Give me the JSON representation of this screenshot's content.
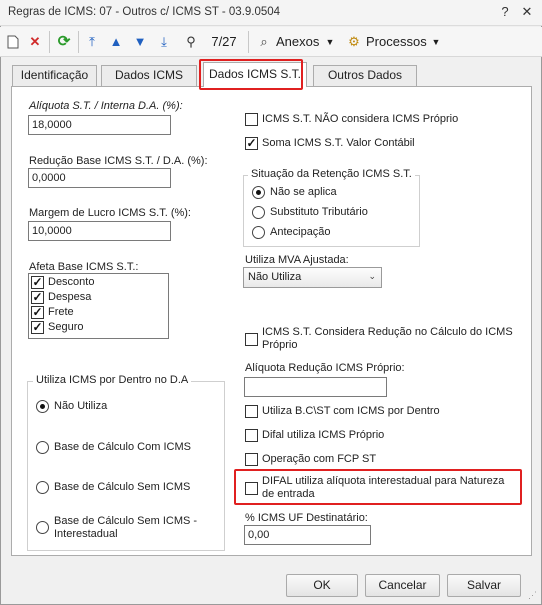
{
  "window": {
    "title": "Regras de ICMS: 07 - Outros c/ ICMS ST - 03.9.0504",
    "help_label": "?",
    "close_label": "✕"
  },
  "toolbar": {
    "record_counter": "7/27",
    "anexos_label": "Anexos",
    "processos_label": "Processos"
  },
  "tabs": [
    "Identificação",
    "Dados ICMS",
    "Dados ICMS S.T.",
    "Outros Dados"
  ],
  "left": {
    "aliquota": {
      "label": "Alíquota S.T. / Interna D.A. (%):",
      "value": "18,0000"
    },
    "reducao": {
      "label": "Redução Base ICMS S.T. / D.A. (%):",
      "value": "0,0000"
    },
    "margem": {
      "label": "Margem de Lucro ICMS S.T. (%):",
      "value": "10,0000"
    },
    "afeta": {
      "label": "Afeta Base ICMS S.T.:",
      "items": [
        {
          "label": "Desconto",
          "checked": true
        },
        {
          "label": "Despesa",
          "checked": true
        },
        {
          "label": "Frete",
          "checked": true
        },
        {
          "label": "Seguro",
          "checked": true
        }
      ]
    },
    "utiliza_dentro": {
      "title": "Utiliza ICMS por Dentro no D.A",
      "options": [
        {
          "label": "Não Utiliza",
          "checked": true
        },
        {
          "label": "Base de Cálculo Com ICMS",
          "checked": false
        },
        {
          "label": "Base de Cálculo Sem ICMS",
          "checked": false
        },
        {
          "label": "Base de Cálculo Sem ICMS - Interestadual",
          "checked": false
        }
      ]
    }
  },
  "right": {
    "nao_considera_proprio": {
      "label": "ICMS S.T. NÃO considera ICMS Próprio",
      "checked": false
    },
    "soma_valor_contabil": {
      "label": "Soma ICMS S.T. Valor Contábil",
      "checked": true
    },
    "situacao": {
      "title": "Situação da Retenção ICMS S.T.",
      "options": [
        {
          "label": "Não se aplica",
          "checked": true
        },
        {
          "label": "Substituto Tributário",
          "checked": false
        },
        {
          "label": "Antecipação",
          "checked": false
        }
      ]
    },
    "mva": {
      "label": "Utiliza MVA Ajustada:",
      "value": "Não Utiliza"
    },
    "considera_reducao": {
      "label": "ICMS S.T. Considera Redução no Cálculo do ICMS Próprio",
      "checked": false
    },
    "aliquota_reducao_proprio": {
      "label": "Alíquota Redução ICMS Próprio:",
      "value": ""
    },
    "utiliza_bc_st": {
      "label": "Utiliza B.C\\ST com ICMS por Dentro",
      "checked": false
    },
    "difal_proprio": {
      "label": "Difal utiliza ICMS Próprio",
      "checked": false
    },
    "operacao_fcp": {
      "label": "Operação com FCP ST",
      "checked": false
    },
    "difal_interestadual": {
      "label": "DIFAL utiliza alíquota interestadual para Natureza de entrada",
      "checked": false
    },
    "icms_uf_destinatario": {
      "label": "% ICMS UF Destinatário:",
      "value": "0,00"
    }
  },
  "buttons": {
    "ok": "OK",
    "cancelar": "Cancelar",
    "salvar": "Salvar"
  },
  "colors": {
    "highlight_border": "#e02020"
  }
}
